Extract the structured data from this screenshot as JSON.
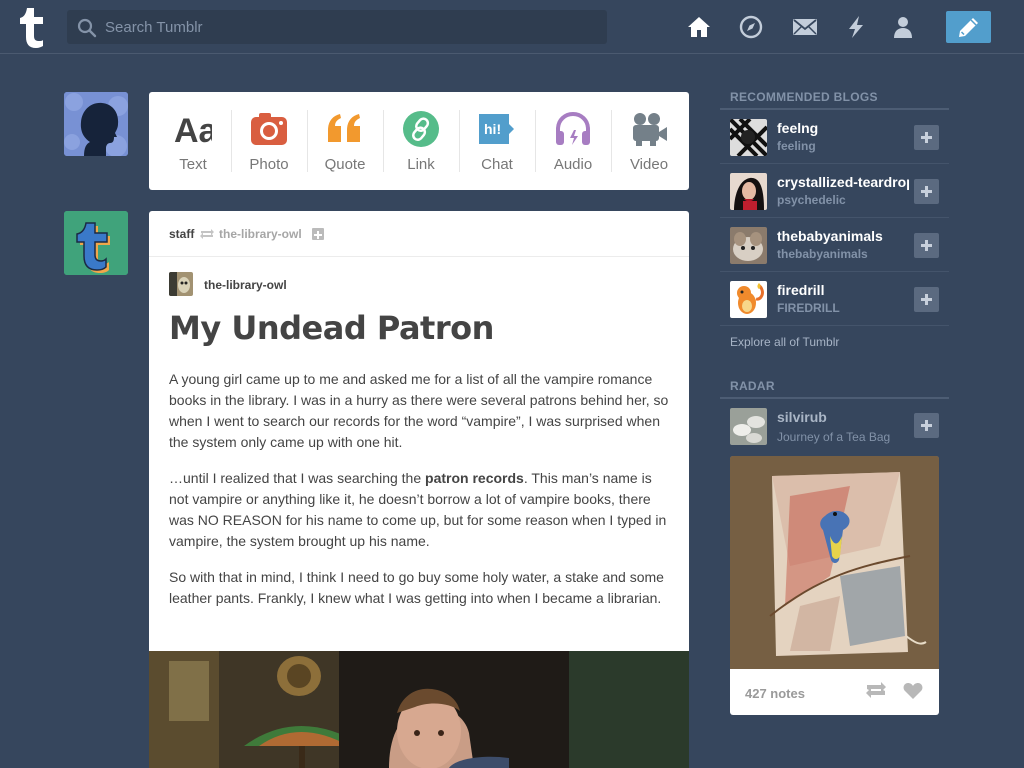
{
  "header": {
    "search_placeholder": "Search Tumblr",
    "nav": [
      "home-icon",
      "explore-compass-icon",
      "inbox-mail-icon",
      "activity-lightning-icon",
      "account-person-icon"
    ],
    "compose_icon": "pencil-icon",
    "accent": "#529ecc"
  },
  "post_types": [
    {
      "label": "Text",
      "icon": "text-aa-icon",
      "color": "#444444"
    },
    {
      "label": "Photo",
      "icon": "camera-icon",
      "color": "#d95e40"
    },
    {
      "label": "Quote",
      "icon": "quote-icon",
      "color": "#f2992e"
    },
    {
      "label": "Link",
      "icon": "link-icon",
      "color": "#56bc8a"
    },
    {
      "label": "Chat",
      "icon": "chat-icon",
      "color": "#529ecc"
    },
    {
      "label": "Audio",
      "icon": "headphones-icon",
      "color": "#a77dc2"
    },
    {
      "label": "Video",
      "icon": "video-camera-icon",
      "color": "#748089"
    }
  ],
  "post": {
    "reblogger": "staff",
    "source": "the-library-owl",
    "author": "the-library-owl",
    "title": "My Undead Patron",
    "p1": "A young girl came up to me and asked me for a list of all the vampire romance books in the library. I was in a hurry as there were several patrons behind her, so when I went to search our records for the word “vampire”, I was surprised when the system only came up with one hit.",
    "p2_start": "…until I realized that I was searching the ",
    "p2_bold": "patron records",
    "p2_end": ". This man’s name is not vampire or anything like it, he doesn’t borrow a lot of vampire books, there was NO REASON for his name to come up, but for some reason when I typed in vampire, the system brought up his name.",
    "p3": "So with that in mind, I think I need to go buy some holy water, a stake and some leather pants. Frankly, I knew what I was getting into when I became a librarian."
  },
  "sidebar": {
    "recommended_title": "RECOMMENDED BLOGS",
    "blogs": [
      {
        "name": "feelng",
        "sub": "feeling"
      },
      {
        "name": "crystallized-teardrops",
        "sub": "psychedelic"
      },
      {
        "name": "thebabyanimals",
        "sub": "thebabyanimals"
      },
      {
        "name": "firedrill",
        "sub": "FIREDRILL"
      }
    ],
    "explore": "Explore all of Tumblr",
    "radar_title": "RADAR",
    "radar": {
      "name": "silvirub",
      "sub": "Journey of a Tea Bag",
      "notes": "427 notes"
    }
  }
}
